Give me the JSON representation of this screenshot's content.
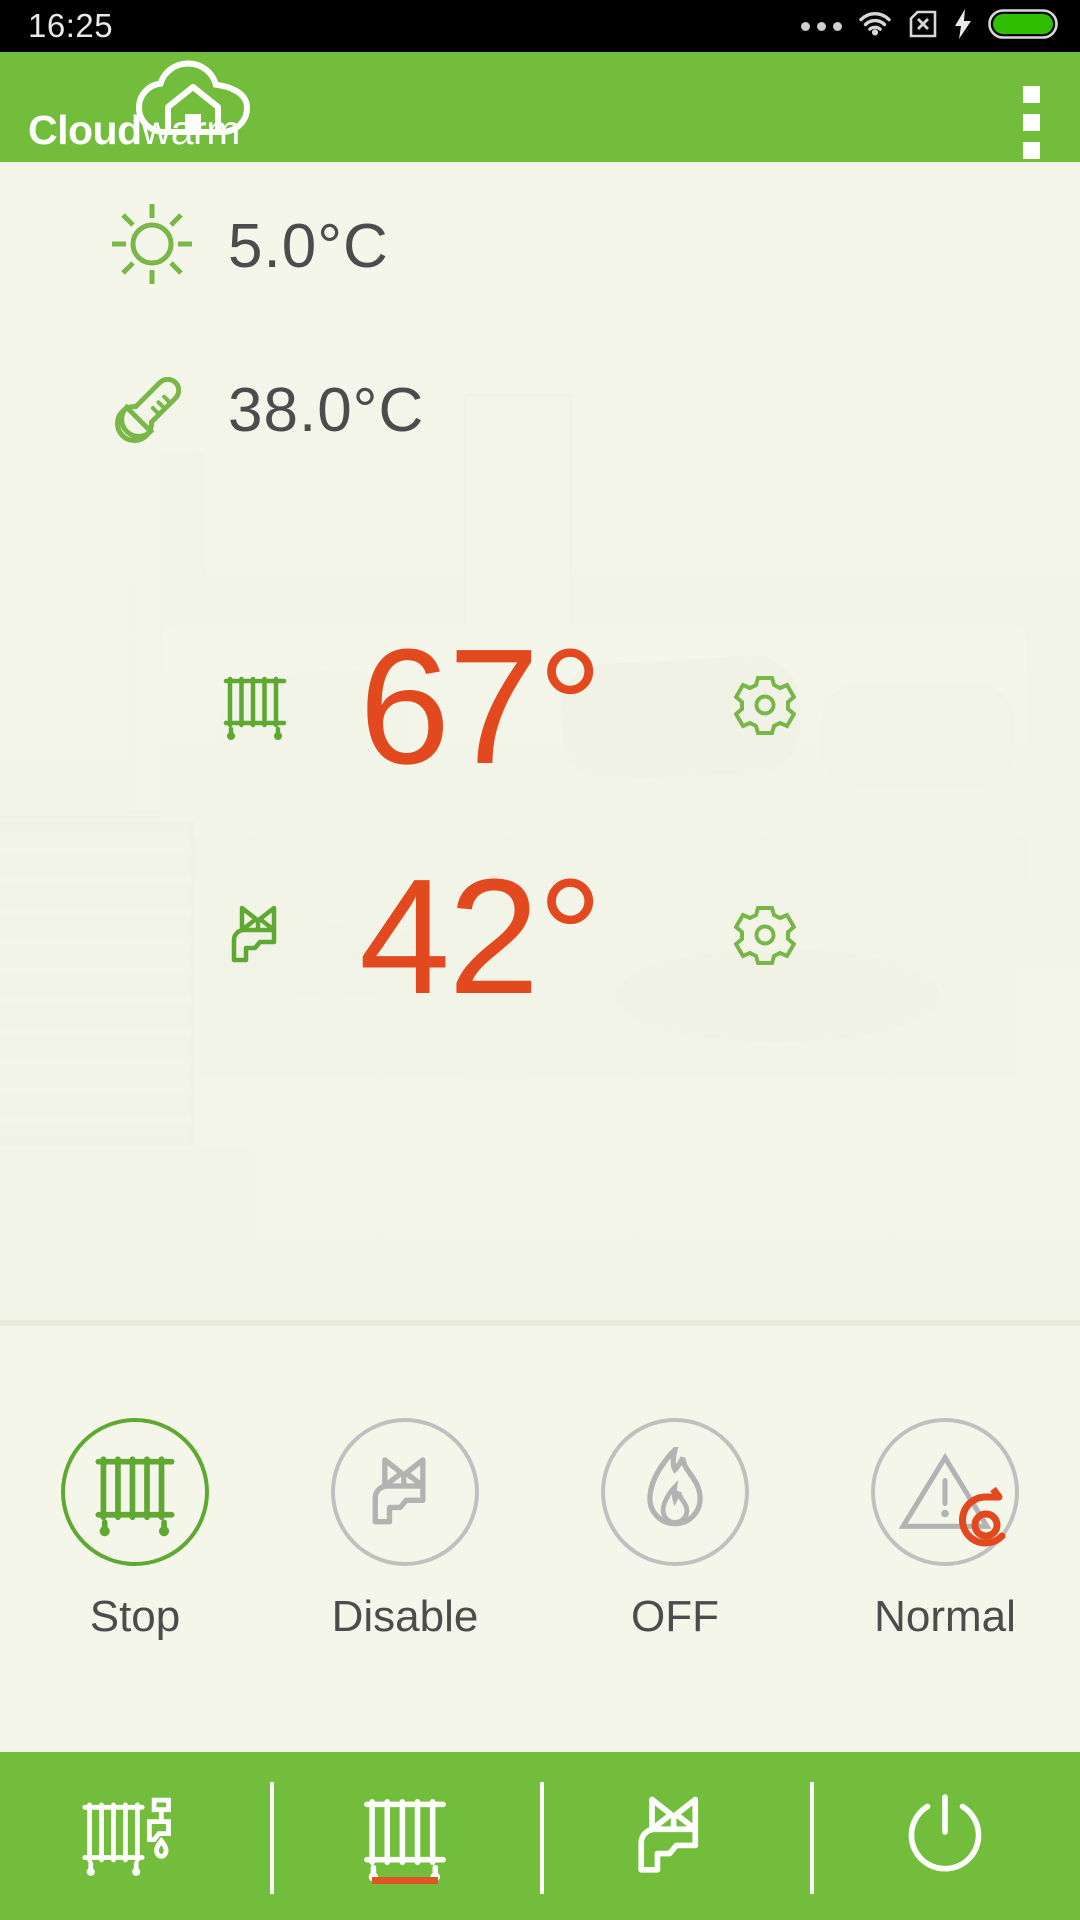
{
  "statusbar": {
    "clock": "16:25",
    "icons": [
      "more-dots-icon",
      "wifi-icon",
      "sim-card-disabled-icon",
      "charging-bolt-icon",
      "battery-full-icon"
    ],
    "battery_color": "#2fbe00"
  },
  "header": {
    "brand_bold": "Cloud",
    "brand_light": "warm",
    "logo_icon": "cloud-house-icon",
    "overflow_icon": "overflow-menu-icon",
    "background_color": "#72bd3b"
  },
  "main": {
    "outdoor": {
      "icon": "sun-icon",
      "value": "5.0°C",
      "icon_color": "#7ab648"
    },
    "water": {
      "icon": "thermometer-icon",
      "value": "38.0°C",
      "icon_color": "#7ab648"
    },
    "heating": {
      "icon": "radiator-icon",
      "value": "67°",
      "gear_icon": "gear-icon",
      "value_color": "#e2491f"
    },
    "dhw": {
      "icon": "faucet-valve-icon",
      "value": "42°",
      "gear_icon": "gear-icon",
      "value_color": "#e2491f"
    }
  },
  "actions": [
    {
      "label": "Stop",
      "icon": "radiator-icon",
      "active": true,
      "badge": null
    },
    {
      "label": "Disable",
      "icon": "faucet-valve-icon",
      "active": false,
      "badge": null
    },
    {
      "label": "OFF",
      "icon": "flame-icon",
      "active": false,
      "badge": null
    },
    {
      "label": "Normal",
      "icon": "warning-triangle-icon",
      "active": false,
      "badge": "refresh-icon"
    }
  ],
  "bottomnav": {
    "items": [
      {
        "icon": "radiator-faucet-icon",
        "active": false
      },
      {
        "icon": "radiator-icon",
        "active": true
      },
      {
        "icon": "faucet-valve-icon",
        "active": false
      },
      {
        "icon": "power-icon",
        "active": false
      }
    ],
    "active_indicator_color": "#de5526"
  }
}
